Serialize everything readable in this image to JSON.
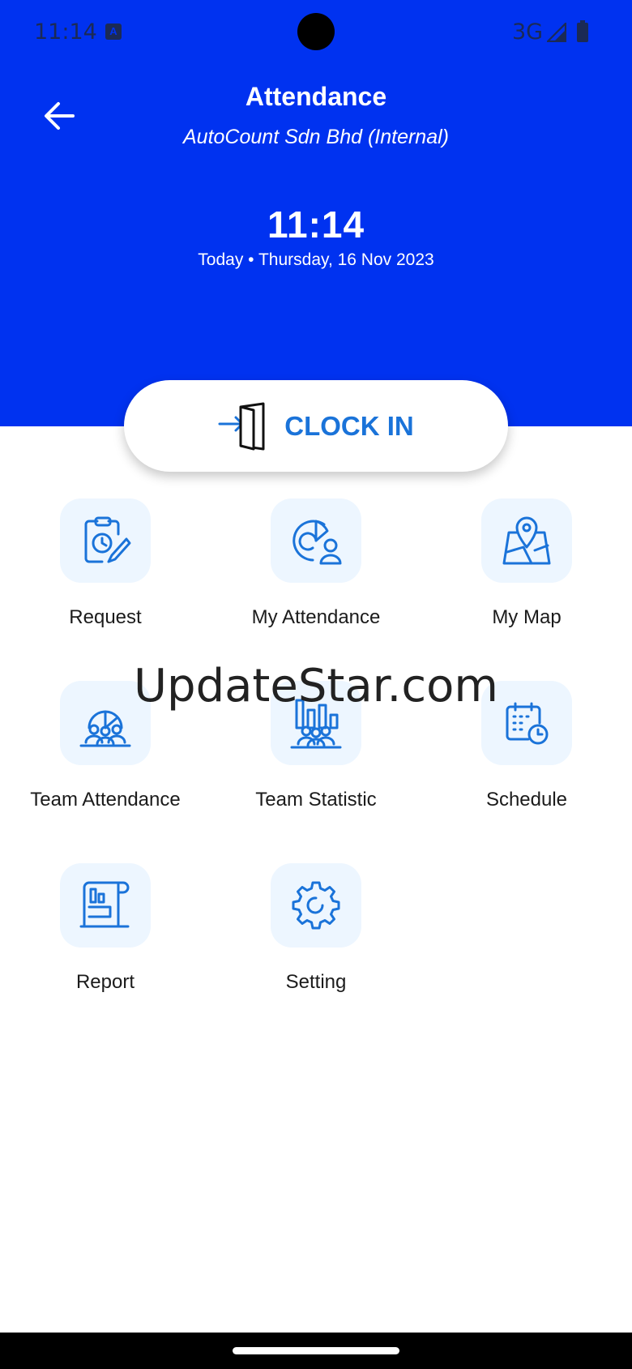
{
  "status_bar": {
    "time": "11:14",
    "network": "3G"
  },
  "header": {
    "title": "Attendance",
    "subtitle": "AutoCount Sdn Bhd (Internal)",
    "clock": "11:14",
    "date": "Today • Thursday, 16 Nov 2023",
    "background_color": "#0032f0"
  },
  "clock_in": {
    "label": "CLOCK IN",
    "icon": "door-enter-icon",
    "color": "#1a73d9"
  },
  "menu": {
    "items": [
      {
        "label": "Request",
        "icon": "clipboard-clock-edit-icon"
      },
      {
        "label": "My Attendance",
        "icon": "chart-user-icon"
      },
      {
        "label": "My Map",
        "icon": "map-pin-icon"
      },
      {
        "label": "Team Attendance",
        "icon": "team-pie-chart-icon"
      },
      {
        "label": "Team Statistic",
        "icon": "team-bar-chart-icon"
      },
      {
        "label": "Schedule",
        "icon": "calendar-clock-icon"
      },
      {
        "label": "Report",
        "icon": "report-scroll-icon"
      },
      {
        "label": "Setting",
        "icon": "gear-icon"
      }
    ]
  },
  "watermark": "UpdateStar.com"
}
